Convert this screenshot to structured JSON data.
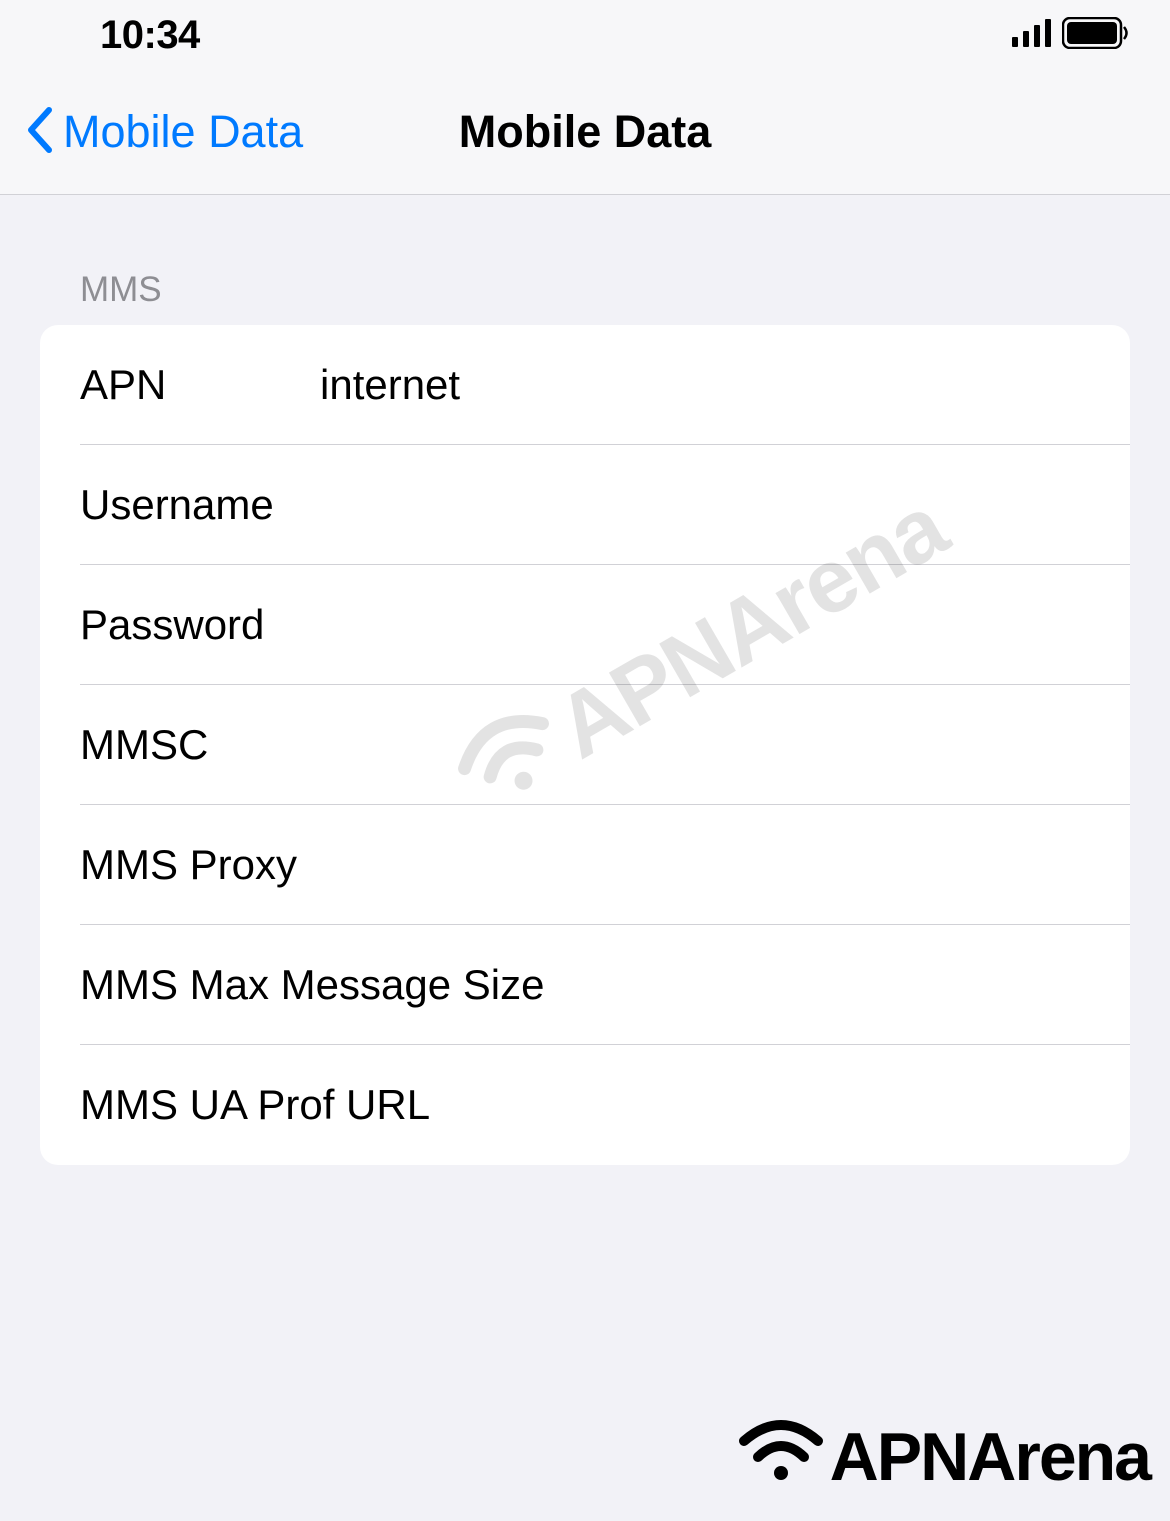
{
  "statusBar": {
    "time": "10:34"
  },
  "nav": {
    "backLabel": "Mobile Data",
    "title": "Mobile Data"
  },
  "section": {
    "header": "MMS",
    "rows": {
      "apn": {
        "label": "APN",
        "value": "internet"
      },
      "username": {
        "label": "Username",
        "value": ""
      },
      "password": {
        "label": "Password",
        "value": ""
      },
      "mmsc": {
        "label": "MMSC",
        "value": ""
      },
      "mmsProxy": {
        "label": "MMS Proxy",
        "value": ""
      },
      "mmsMax": {
        "label": "MMS Max Message Size",
        "value": ""
      },
      "mmsUaProf": {
        "label": "MMS UA Prof URL",
        "value": ""
      }
    }
  },
  "watermark": {
    "text": "APNArena"
  }
}
